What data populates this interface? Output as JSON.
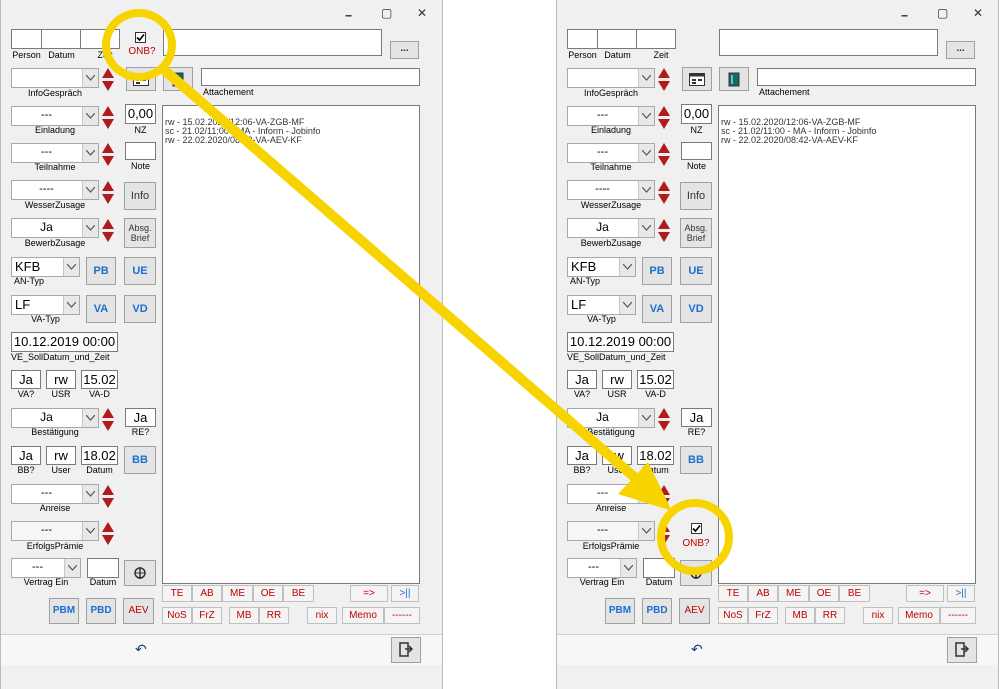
{
  "window": {
    "minimize_glyph": "🗕",
    "maximize_glyph": "▢",
    "close_glyph": "✕"
  },
  "header": {
    "person_label": "Person",
    "datum_label": "Datum",
    "zeit_label": "Zeit",
    "onb_label": "ONB?",
    "more_label": "..."
  },
  "fields": {
    "infogesprach_label": "InfoGespräch",
    "attachement_label": "Attachement",
    "einladung_value": "---",
    "einladung_label": "Einladung",
    "nz_value": "0,00",
    "nz_label": "NZ",
    "teilnahme_value": "---",
    "teilnahme_label": "Teilnahme",
    "note_label": "Note",
    "wesserzusage_value": "----",
    "wesserzusage_label": "WesserZusage",
    "info_button": "Info",
    "bewerbzusage_value": "Ja",
    "bewerbzusage_label": "BewerbZusage",
    "absg_line1": "Absg.",
    "absg_line2": "Brief",
    "antyp_value": "KFB",
    "antyp_label": "AN-Typ",
    "pb_button": "PB",
    "ue_button": "UE",
    "vatyp_value": "LF",
    "vatyp_label": "VA-Typ",
    "va_button": "VA",
    "vd_button": "VD",
    "solldatum_value": "10.12.2019 00:00",
    "solldatum_label": "VE_SollDatum_und_Zeit",
    "va_q_value": "Ja",
    "va_q_label": "VA?",
    "usr_value": "rw",
    "usr_label": "USR",
    "vad_value": "15.02",
    "vad_label": "VA-D",
    "bestatigung_value": "Ja",
    "bestatigung_label": "Bestätigung",
    "re_value": "Ja",
    "re_label": "RE?",
    "bb_q_value": "Ja",
    "bb_q_label": "BB?",
    "user_value": "rw",
    "user_label": "User",
    "bbdatum_value": "18.02",
    "bbdatum_label": "Datum",
    "bb_button": "BB",
    "anreise_value": "---",
    "anreise_label": "Anreise",
    "erfolgspramie_value": "---",
    "erfolgspramie_label": "ErfolgsPrämie",
    "vertrag_value": "---",
    "vertrag_label": "Vertrag Ein",
    "vertrag_datum_label": "Datum"
  },
  "memo_lines": [
    "rw - 15.02.2020/12:06-VA-ZGB-MF",
    "sc - 21.02/11:00 - MA - Inform - Jobinfo",
    "rw - 22.02.2020/08:42-VA-AEV-KF"
  ],
  "tabs_row1": [
    "TE",
    "AB",
    "ME",
    "OE",
    "BE"
  ],
  "tabs_row1_right": [
    "=>",
    ">||"
  ],
  "tabs_row2": [
    "NoS",
    "FrZ",
    "MB",
    "RR",
    "nix",
    "Memo",
    "------"
  ],
  "bottom_buttons": {
    "pbm": "PBM",
    "pbd": "PBD",
    "aev": "AEV"
  },
  "footer": {
    "undo_glyph": "↶"
  },
  "colors": {
    "accent_blue": "#1a6fd1",
    "accent_red": "#c00000",
    "highlight": "#f7d400"
  }
}
